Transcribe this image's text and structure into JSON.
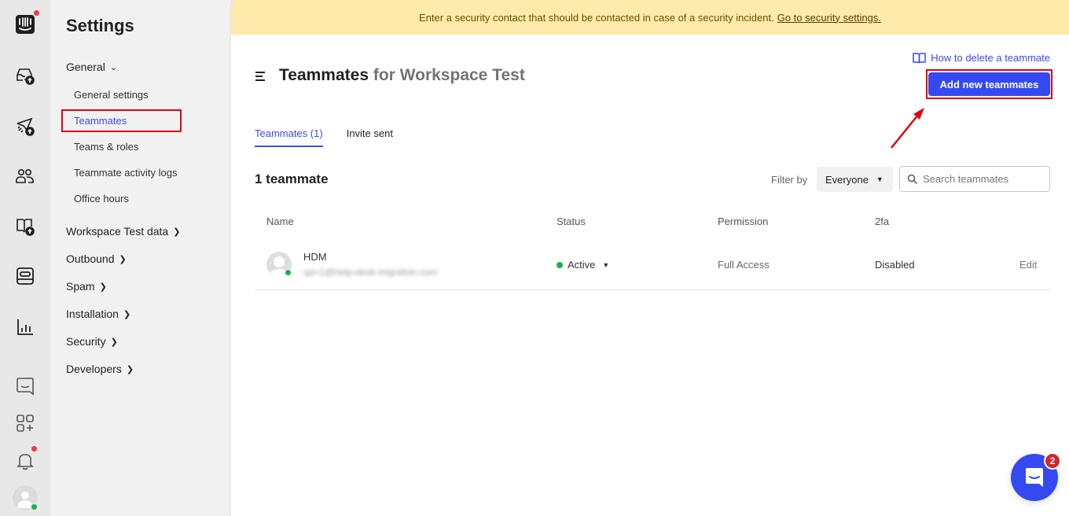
{
  "rail": {
    "items": [
      {
        "name": "logo",
        "icon": "intercom-logo-icon"
      },
      {
        "name": "inbox",
        "icon": "inbox-upgrade-icon"
      },
      {
        "name": "outbound",
        "icon": "send-upgrade-icon"
      },
      {
        "name": "contacts",
        "icon": "people-icon"
      },
      {
        "name": "articles",
        "icon": "book-upgrade-icon"
      },
      {
        "name": "apps",
        "icon": "browser-icon"
      },
      {
        "name": "reports",
        "icon": "bar-chart-icon"
      },
      {
        "name": "messenger",
        "icon": "chat-icon"
      },
      {
        "name": "app-store",
        "icon": "apps-add-icon"
      },
      {
        "name": "notifications",
        "icon": "bell-icon"
      },
      {
        "name": "profile",
        "icon": "avatar-icon"
      }
    ]
  },
  "settings": {
    "title": "Settings",
    "general": {
      "label": "General",
      "items": [
        "General settings",
        "Teammates",
        "Teams & roles",
        "Teammate activity logs",
        "Office hours"
      ]
    },
    "sections": [
      "Workspace Test data",
      "Outbound",
      "Spam",
      "Installation",
      "Security",
      "Developers"
    ]
  },
  "banner": {
    "text": "Enter a security contact that should be contacted in case of a security incident.",
    "link": "Go to security settings."
  },
  "header": {
    "title": "Teammates",
    "subtitle": "for Workspace Test",
    "help_link": "How to delete a teammate",
    "add_button": "Add new teammates"
  },
  "tabs": [
    {
      "label": "Teammates (1)",
      "active": true
    },
    {
      "label": "Invite sent",
      "active": false
    }
  ],
  "list": {
    "count_label": "1 teammate",
    "filter_label": "Filter by",
    "filter_value": "Everyone",
    "search_placeholder": "Search teammates",
    "columns": [
      "Name",
      "Status",
      "Permission",
      "2fa"
    ],
    "rows": [
      {
        "name": "HDM",
        "email": "qa+1@help-desk-migration.com",
        "status": "Active",
        "permission": "Full Access",
        "twofa": "Disabled",
        "action": "Edit"
      }
    ]
  },
  "messenger": {
    "badge": "2"
  },
  "colors": {
    "accent": "#3549f2",
    "banner_bg": "#feeaab",
    "active_green": "#1fad4c",
    "annotation_red": "#e3000f"
  }
}
